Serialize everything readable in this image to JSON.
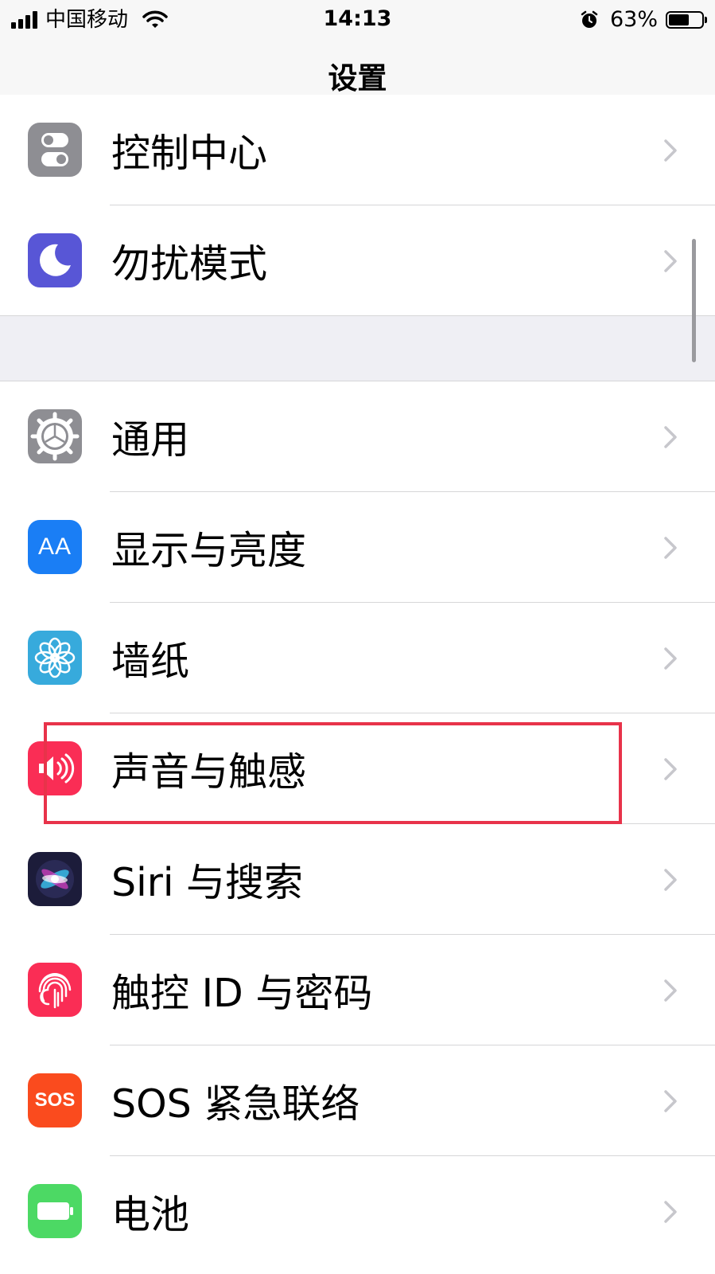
{
  "status_bar": {
    "carrier": "中国移动",
    "time": "14:13",
    "battery_percent": "63%",
    "battery_level": 0.63
  },
  "nav": {
    "title": "设置"
  },
  "settings": [
    {
      "label": "控制中心",
      "icon": "control-center-icon",
      "color": "#8e8e93"
    },
    {
      "label": "勿扰模式",
      "icon": "moon-icon",
      "color": "#5856d6"
    },
    {
      "label": "通用",
      "icon": "gear-icon",
      "color": "#8e8e93"
    },
    {
      "label": "显示与亮度",
      "icon": "text-size-icon",
      "color": "#1a7ef5",
      "icon_text": "AA"
    },
    {
      "label": "墙纸",
      "icon": "flower-icon",
      "color": "#37aadc"
    },
    {
      "label": "声音与触感",
      "icon": "speaker-icon",
      "color": "#fa2d55"
    },
    {
      "label": "Siri 与搜索",
      "icon": "siri-icon",
      "color": "#1c1c3a"
    },
    {
      "label": "触控 ID 与密码",
      "icon": "fingerprint-icon",
      "color": "#fa2d55"
    },
    {
      "label": "SOS 紧急联络",
      "icon": "sos-icon",
      "color": "#fa4b1e",
      "icon_text": "SOS"
    },
    {
      "label": "电池",
      "icon": "battery-icon",
      "color": "#4cd964"
    }
  ],
  "highlight_color": "#e8334a"
}
